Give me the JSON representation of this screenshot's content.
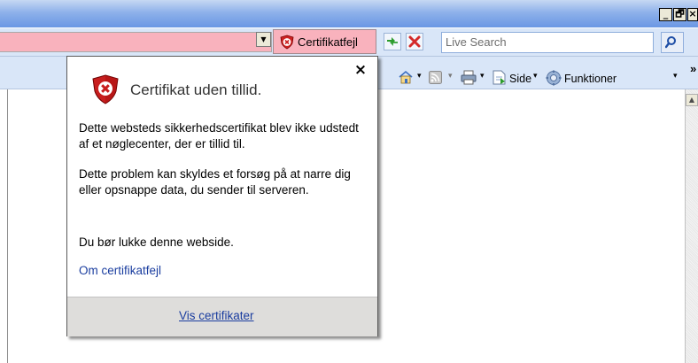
{
  "window": {
    "minimize_label": "_",
    "restore_label": "🗗",
    "close_label": "×"
  },
  "addressbar": {
    "dropdown_glyph": "▼",
    "cert_error_label": "Certifikatfejl",
    "search_placeholder": "Live Search",
    "colors": {
      "error_bg": "#f9b2bd"
    }
  },
  "commandbar": {
    "page_label": "Side",
    "tools_label": "Funktioner",
    "chevron": "»",
    "dropdown_glyph": "▾"
  },
  "popup": {
    "close_label": "×",
    "title": "Certifikat uden tillid.",
    "paragraph1": "Dette websteds sikkerhedscertifikat blev ikke udstedt af et nøglecenter, der er tillid til.",
    "paragraph2": "Dette problem kan skyldes et forsøg på at narre dig eller opsnappe data, du sender til serveren.",
    "paragraph3": "Du bør lukke denne webside.",
    "link": "Om certifikatfejl",
    "footer_link": "Vis certifikater"
  },
  "icons": [
    "shield-error-icon",
    "refresh-icon",
    "stop-icon",
    "search-icon",
    "home-icon",
    "feeds-icon",
    "print-icon",
    "page-icon",
    "tools-icon",
    "scroll-up-icon"
  ]
}
